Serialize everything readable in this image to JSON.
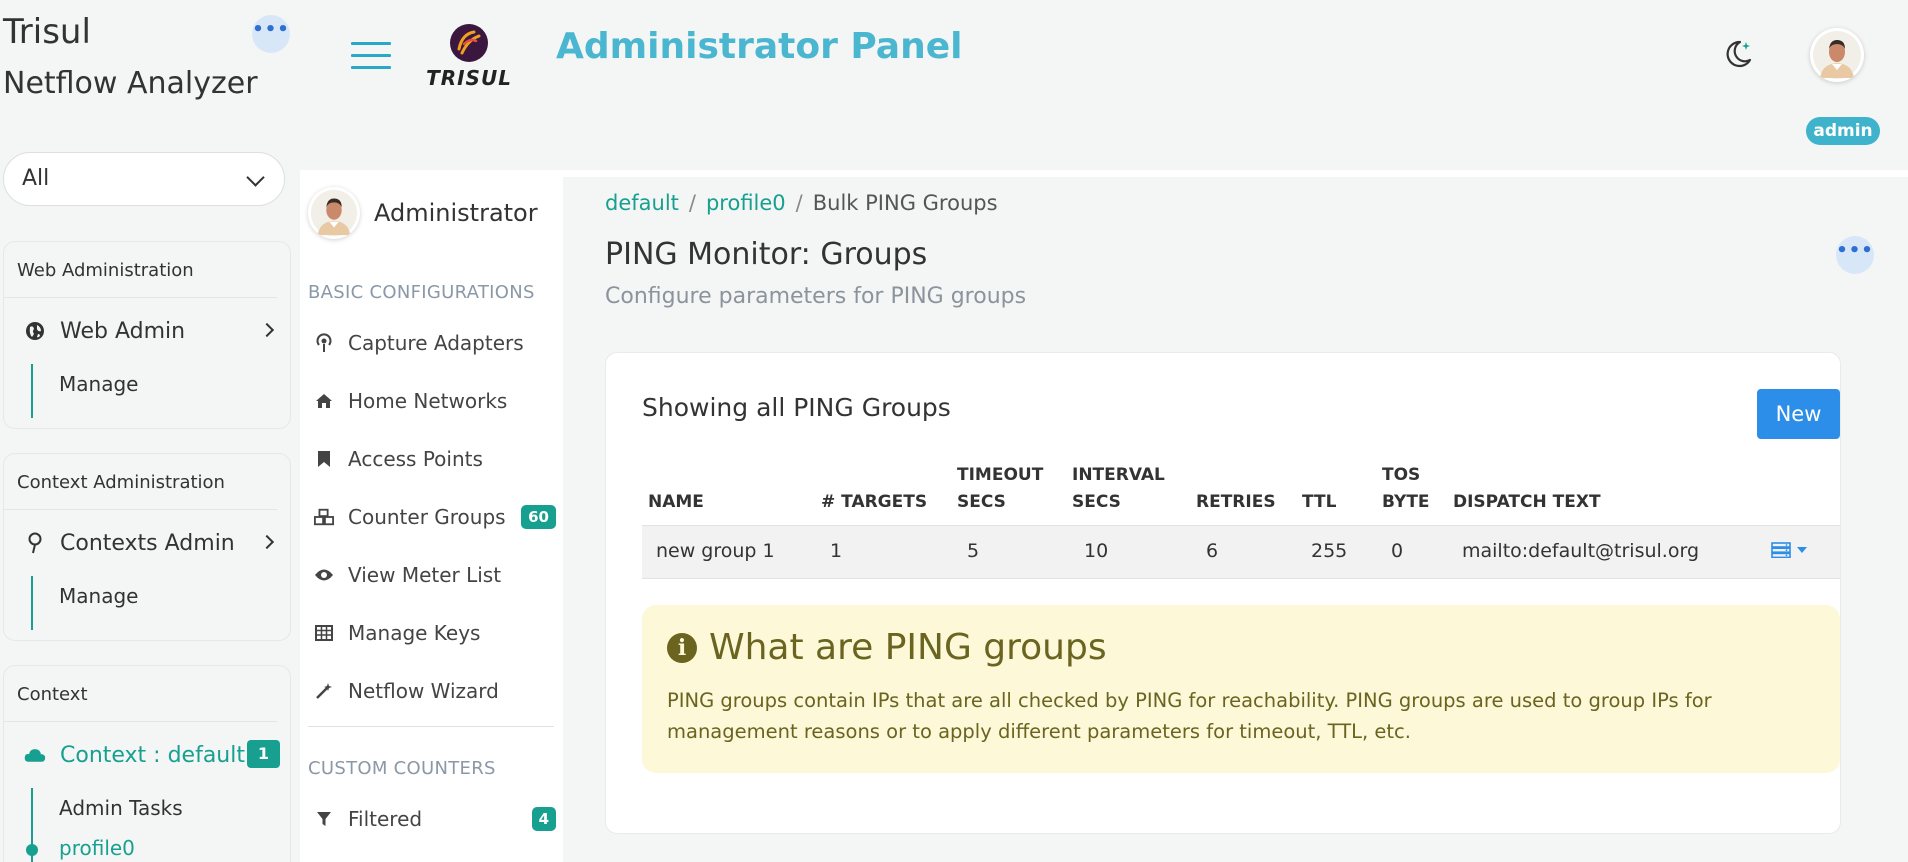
{
  "app": {
    "title": "Trisul",
    "subtitle": "Netflow Analyzer",
    "context_select": "All"
  },
  "header": {
    "panel_title": "Administrator Panel",
    "logo_text": "TRISUL",
    "user_badge": "admin"
  },
  "sidebar": {
    "web_admin": {
      "heading": "Web Administration",
      "item": "Web Admin",
      "sub": "Manage"
    },
    "context_admin": {
      "heading": "Context Administration",
      "item": "Contexts Admin",
      "sub": "Manage"
    },
    "context": {
      "heading": "Context",
      "item": "Context : default",
      "count": "1",
      "subs": [
        "Admin Tasks",
        "profile0"
      ]
    }
  },
  "subnav": {
    "user": "Administrator",
    "basic_heading": "BASIC CONFIGURATIONS",
    "items": [
      {
        "label": "Capture Adapters",
        "icon": "podcast-icon"
      },
      {
        "label": "Home Networks",
        "icon": "home-icon"
      },
      {
        "label": "Access Points",
        "icon": "bookmark-icon"
      },
      {
        "label": "Counter Groups",
        "icon": "cubes-icon",
        "badge": "60"
      },
      {
        "label": "View Meter List",
        "icon": "eye-icon"
      },
      {
        "label": "Manage Keys",
        "icon": "table-icon"
      },
      {
        "label": "Netflow Wizard",
        "icon": "magic-wand-icon"
      }
    ],
    "custom_heading": "CUSTOM COUNTERS",
    "custom_items": [
      {
        "label": "Filtered",
        "icon": "filter-icon",
        "badge": "4"
      }
    ]
  },
  "breadcrumb": [
    "default",
    "profile0",
    "Bulk PING Groups"
  ],
  "page": {
    "title": "PING Monitor: Groups",
    "subtitle": "Configure parameters for PING groups"
  },
  "card": {
    "title": "Showing all PING Groups",
    "new_button": "New",
    "columns": [
      [
        "NAME"
      ],
      [
        "# TARGETS"
      ],
      [
        "TIMEOUT",
        "SECS"
      ],
      [
        "INTERVAL",
        "SECS"
      ],
      [
        "RETRIES"
      ],
      [
        "TTL"
      ],
      [
        "TOS",
        "BYTE"
      ],
      [
        "DISPATCH TEXT"
      ]
    ],
    "rows": [
      [
        "new group 1",
        "1",
        "5",
        "10",
        "6",
        "255",
        "0",
        "mailto:default@trisul.org"
      ]
    ]
  },
  "info": {
    "title": "What are PING groups",
    "text": "PING groups contain IPs that are all checked by PING for reachability. PING groups are used to group IPs for management reasons or to apply different parameters for timeout, TTL, etc."
  },
  "colors": {
    "accent": "#17a08f",
    "header_title": "#4ab6cf",
    "primary_button": "#2c8ee8",
    "info_bg": "#fcf8d8",
    "info_text": "#6a6420"
  }
}
